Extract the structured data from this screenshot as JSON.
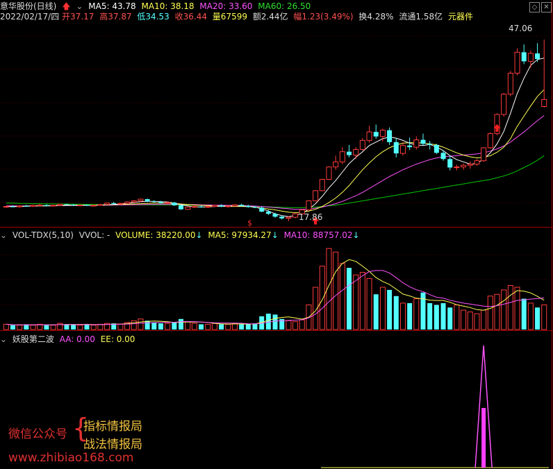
{
  "header": {
    "stock": "意华股份(日线)",
    "ma5_label": "MA5: 43.78",
    "ma10_label": "MA10: 38.18",
    "ma20_label": "MA20: 33.60",
    "ma60_label": "MA60: 26.50",
    "date": "2022/02/17/四",
    "open": "开37.17",
    "high": "高37.87",
    "low": "低34.53",
    "close": "收36.44",
    "vol": "量67599",
    "amount": "额2.44亿",
    "change": "幅1.23(3.49%)",
    "turnover": "换4.28%",
    "float": "流通1.58亿",
    "sector": "元器件"
  },
  "volume_header": {
    "name": "VOL-TDX(5,10)",
    "vvol": "VVOL: -",
    "volume": "VOLUME: 38220.00",
    "ma5": "MA5: 97934.27",
    "ma10": "MA10: 88757.02"
  },
  "indicator_header": {
    "name": "妖股第二波",
    "aa": "AA: 0.00",
    "ee": "EE: 0.00"
  },
  "annotations": {
    "high_price": "47.06",
    "low_price": "17.86"
  },
  "watermark": {
    "wechat": "微信公众号",
    "brand1": "指标情报局",
    "brand2": "战法情报局",
    "url": "www.zhibiao168.com"
  },
  "colors": {
    "up": "#ff3c3c",
    "down": "#54ffff",
    "ma5": "#ffffff",
    "ma10": "#ffff54",
    "ma20": "#ff54ff",
    "ma60": "#00c800"
  },
  "chart_data": {
    "type": "candlestick",
    "price_range": [
      15,
      50
    ],
    "candles": [
      [
        17.4,
        17.6,
        17.3,
        17.5
      ],
      [
        17.5,
        17.7,
        17.4,
        17.45
      ],
      [
        17.45,
        17.7,
        17.3,
        17.6
      ],
      [
        17.6,
        17.8,
        17.5,
        17.55
      ],
      [
        17.55,
        17.8,
        17.4,
        17.7
      ],
      [
        17.7,
        17.9,
        17.6,
        17.75
      ],
      [
        17.75,
        17.9,
        17.5,
        17.6
      ],
      [
        17.6,
        17.8,
        17.5,
        17.7
      ],
      [
        17.7,
        18.0,
        17.6,
        17.9
      ],
      [
        17.9,
        18.0,
        17.7,
        17.8
      ],
      [
        17.8,
        17.95,
        17.6,
        17.7
      ],
      [
        17.7,
        17.85,
        17.55,
        17.75
      ],
      [
        17.75,
        17.9,
        17.6,
        17.65
      ],
      [
        17.65,
        17.8,
        17.5,
        17.7
      ],
      [
        17.7,
        17.9,
        17.6,
        17.85
      ],
      [
        17.85,
        18.2,
        17.8,
        18.1
      ],
      [
        18.1,
        18.3,
        17.9,
        17.95
      ],
      [
        17.95,
        18.1,
        17.8,
        18.05
      ],
      [
        18.05,
        18.4,
        18.0,
        18.3
      ],
      [
        18.3,
        18.6,
        18.2,
        18.5
      ],
      [
        18.5,
        18.9,
        18.3,
        18.8
      ],
      [
        18.8,
        18.9,
        18.3,
        18.4
      ],
      [
        18.4,
        18.6,
        18.2,
        18.3
      ],
      [
        18.3,
        18.5,
        18.0,
        18.1
      ],
      [
        18.1,
        18.4,
        17.9,
        18.2
      ],
      [
        18.2,
        18.3,
        17.6,
        17.7
      ],
      [
        17.7,
        17.8,
        16.9,
        17.0
      ],
      [
        17.0,
        17.5,
        16.9,
        17.4
      ],
      [
        17.4,
        17.6,
        17.2,
        17.5
      ],
      [
        17.5,
        17.7,
        17.3,
        17.4
      ],
      [
        17.4,
        17.6,
        17.2,
        17.5
      ],
      [
        17.5,
        17.8,
        17.4,
        17.7
      ],
      [
        17.7,
        17.9,
        17.4,
        17.5
      ],
      [
        17.5,
        17.7,
        17.3,
        17.6
      ],
      [
        17.6,
        17.9,
        17.5,
        17.8
      ],
      [
        17.8,
        18.0,
        17.5,
        17.6
      ],
      [
        17.6,
        17.8,
        17.3,
        17.4
      ],
      [
        17.4,
        17.6,
        17.2,
        17.3
      ],
      [
        17.3,
        17.5,
        16.5,
        16.6
      ],
      [
        16.6,
        16.9,
        16.0,
        16.2
      ],
      [
        16.2,
        16.4,
        15.5,
        15.7
      ],
      [
        15.7,
        15.9,
        15.2,
        15.4
      ],
      [
        15.4,
        15.8,
        14.9,
        15.6
      ],
      [
        15.6,
        16.3,
        15.4,
        16.2
      ],
      [
        16.2,
        17.0,
        16.0,
        16.9
      ],
      [
        16.9,
        18.6,
        16.8,
        18.5
      ],
      [
        18.5,
        20.4,
        18.4,
        20.3
      ],
      [
        20.3,
        22.4,
        20.2,
        22.3
      ],
      [
        22.3,
        24.6,
        22.2,
        24.5
      ],
      [
        24.5,
        26.5,
        24.0,
        25.4
      ],
      [
        25.4,
        28.0,
        25.0,
        27.2
      ],
      [
        27.2,
        28.4,
        26.2,
        26.6
      ],
      [
        26.6,
        28.0,
        25.9,
        27.6
      ],
      [
        27.6,
        29.6,
        27.4,
        29.2
      ],
      [
        29.2,
        31.8,
        28.8,
        30.7
      ],
      [
        30.7,
        32.0,
        29.5,
        29.9
      ],
      [
        29.9,
        31.3,
        29.0,
        31.0
      ],
      [
        31.0,
        31.5,
        28.4,
        28.9
      ],
      [
        28.9,
        29.6,
        26.2,
        26.9
      ],
      [
        26.9,
        28.9,
        26.5,
        28.3
      ],
      [
        28.3,
        29.7,
        27.5,
        28.0
      ],
      [
        28.0,
        29.9,
        27.6,
        29.3
      ],
      [
        29.3,
        30.4,
        28.3,
        28.6
      ],
      [
        28.6,
        29.1,
        27.6,
        28.4
      ],
      [
        28.4,
        28.6,
        26.8,
        27.0
      ],
      [
        27.0,
        27.5,
        25.6,
        25.9
      ],
      [
        25.9,
        26.5,
        23.9,
        24.4
      ],
      [
        24.4,
        24.9,
        23.9,
        24.5
      ],
      [
        24.5,
        25.1,
        24.0,
        24.8
      ],
      [
        24.8,
        25.5,
        24.2,
        25.0
      ],
      [
        25.0,
        25.9,
        24.7,
        25.6
      ],
      [
        25.6,
        28.0,
        25.4,
        27.9
      ],
      [
        27.9,
        30.6,
        27.7,
        30.4
      ],
      [
        30.4,
        34.0,
        30.1,
        33.8
      ],
      [
        33.8,
        37.6,
        33.4,
        37.4
      ],
      [
        37.4,
        41.5,
        37.0,
        41.1
      ],
      [
        41.1,
        45.5,
        40.7,
        44.8
      ],
      [
        44.8,
        46.2,
        42.7,
        43.2
      ],
      [
        43.2,
        45.1,
        42.1,
        44.6
      ],
      [
        44.6,
        46.4,
        43.1,
        43.6
      ],
      [
        35.2,
        47.06,
        35.0,
        36.44
      ]
    ],
    "volumes": [
      6,
      5,
      5,
      6,
      5,
      6,
      5,
      5,
      7,
      6,
      6,
      5,
      6,
      5,
      6,
      7,
      7,
      6,
      8,
      10,
      12,
      10,
      8,
      7,
      7,
      8,
      12,
      9,
      7,
      6,
      6,
      7,
      6,
      6,
      7,
      6,
      6,
      7,
      15,
      18,
      17,
      12,
      10,
      9,
      11,
      28,
      48,
      72,
      92,
      88,
      75,
      70,
      62,
      65,
      58,
      40,
      48,
      45,
      38,
      30,
      30,
      35,
      42,
      30,
      28,
      30,
      25,
      28,
      22,
      20,
      18,
      22,
      38,
      40,
      45,
      50,
      48,
      35,
      30,
      25,
      28
    ],
    "ma5": [
      17.5,
      17.5,
      17.5,
      17.55,
      17.6,
      17.62,
      17.65,
      17.68,
      17.72,
      17.74,
      17.76,
      17.75,
      17.72,
      17.7,
      17.73,
      17.8,
      17.85,
      17.95,
      18.05,
      18.2,
      18.35,
      18.4,
      18.4,
      18.35,
      18.3,
      18.1,
      17.8,
      17.6,
      17.45,
      17.4,
      17.45,
      17.5,
      17.55,
      17.6,
      17.62,
      17.6,
      17.55,
      17.4,
      17.1,
      16.7,
      16.2,
      15.9,
      15.7,
      15.9,
      16.3,
      17.0,
      18.0,
      19.3,
      20.8,
      22.1,
      23.6,
      25.1,
      26.2,
      27.2,
      28.3,
      28.9,
      29.5,
      29.8,
      29.6,
      29.2,
      28.7,
      28.4,
      28.3,
      28.5,
      28.0,
      27.4,
      26.5,
      25.8,
      25.4,
      25.0,
      25.1,
      25.9,
      27.0,
      28.6,
      30.8,
      34.0,
      37.5,
      40.2,
      42.5,
      43.5,
      43.78
    ],
    "ma10": [
      17.5,
      17.5,
      17.52,
      17.55,
      17.58,
      17.6,
      17.62,
      17.64,
      17.66,
      17.7,
      17.72,
      17.72,
      17.72,
      17.72,
      17.74,
      17.78,
      17.82,
      17.86,
      17.9,
      17.95,
      18.0,
      18.05,
      18.1,
      18.1,
      18.1,
      18.05,
      17.95,
      17.85,
      17.75,
      17.7,
      17.65,
      17.6,
      17.55,
      17.5,
      17.5,
      17.5,
      17.48,
      17.4,
      17.25,
      17.05,
      16.9,
      16.7,
      16.5,
      16.4,
      16.5,
      16.7,
      17.0,
      17.5,
      18.2,
      19.0,
      20.0,
      21.2,
      22.6,
      24.0,
      25.2,
      26.3,
      27.2,
      27.9,
      28.4,
      28.7,
      28.8,
      28.8,
      28.7,
      28.6,
      28.4,
      28.0,
      27.5,
      27.0,
      26.6,
      26.3,
      26.1,
      26.2,
      26.5,
      27.1,
      28.0,
      29.5,
      31.7,
      33.5,
      35.3,
      37.0,
      38.18
    ],
    "ma20": [
      17.6,
      17.6,
      17.6,
      17.6,
      17.6,
      17.62,
      17.62,
      17.63,
      17.64,
      17.65,
      17.66,
      17.67,
      17.68,
      17.7,
      17.72,
      17.74,
      17.76,
      17.78,
      17.8,
      17.82,
      17.84,
      17.86,
      17.88,
      17.9,
      17.9,
      17.9,
      17.88,
      17.86,
      17.84,
      17.8,
      17.78,
      17.75,
      17.72,
      17.7,
      17.68,
      17.65,
      17.62,
      17.58,
      17.5,
      17.4,
      17.3,
      17.2,
      17.1,
      17.0,
      17.0,
      17.05,
      17.2,
      17.4,
      17.7,
      18.0,
      18.4,
      18.9,
      19.4,
      20.0,
      20.7,
      21.4,
      22.1,
      22.8,
      23.4,
      24.0,
      24.5,
      25.0,
      25.4,
      25.8,
      26.1,
      26.3,
      26.4,
      26.5,
      26.6,
      26.7,
      26.8,
      27.0,
      27.3,
      27.7,
      28.2,
      28.9,
      29.8,
      30.7,
      31.7,
      32.7,
      33.6
    ],
    "ma60": [
      18.1,
      18.1,
      18.05,
      18.05,
      18.0,
      18.0,
      17.98,
      17.96,
      17.95,
      17.93,
      17.92,
      17.9,
      17.88,
      17.87,
      17.86,
      17.85,
      17.84,
      17.83,
      17.82,
      17.81,
      17.8,
      17.8,
      17.8,
      17.8,
      17.8,
      17.8,
      17.78,
      17.76,
      17.74,
      17.72,
      17.7,
      17.68,
      17.66,
      17.64,
      17.62,
      17.6,
      17.58,
      17.55,
      17.5,
      17.45,
      17.4,
      17.35,
      17.3,
      17.3,
      17.3,
      17.35,
      17.4,
      17.5,
      17.6,
      17.75,
      17.9,
      18.1,
      18.3,
      18.5,
      18.7,
      18.9,
      19.1,
      19.3,
      19.5,
      19.7,
      19.9,
      20.1,
      20.3,
      20.5,
      20.7,
      20.9,
      21.1,
      21.3,
      21.5,
      21.7,
      21.9,
      22.1,
      22.3,
      22.6,
      22.9,
      23.3,
      23.8,
      24.4,
      25.0,
      25.7,
      26.5
    ],
    "signal": {
      "type": "spike",
      "index": 71,
      "value": 1
    }
  }
}
